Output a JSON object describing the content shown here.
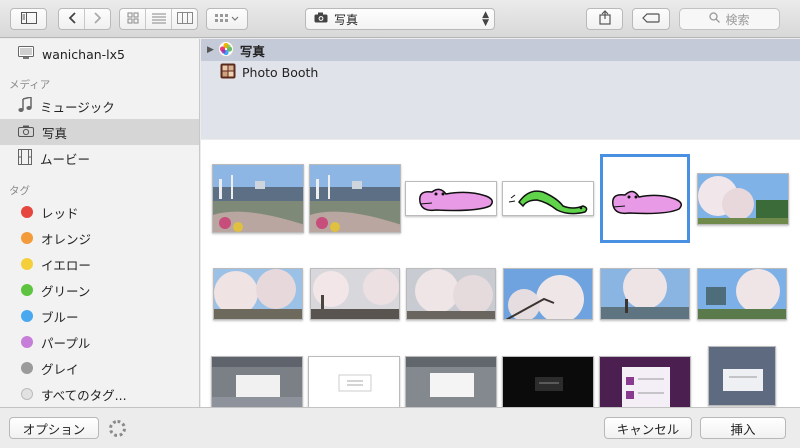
{
  "toolbar": {
    "source_popup": {
      "label": "写真",
      "icon": "camera-icon"
    },
    "search": {
      "placeholder": "検索",
      "icon": "magnifier-icon"
    },
    "icons": [
      "sidebar-toggle-icon",
      "back-arrow-icon",
      "forward-arrow-icon",
      "icon-view-icon",
      "list-view-icon",
      "column-view-icon",
      "group-by-icon",
      "share-icon",
      "tag-icon"
    ]
  },
  "sidebar": {
    "device": {
      "label": "wanichan-lx5",
      "icon": "computer-icon"
    },
    "media_header": "メディア",
    "media": [
      {
        "label": "ミュージック",
        "icon": "music-note-icon"
      },
      {
        "label": "写真",
        "icon": "camera-icon",
        "selected": true
      },
      {
        "label": "ムービー",
        "icon": "film-icon"
      }
    ],
    "tags_header": "タグ",
    "tags": [
      {
        "label": "レッド",
        "color": "#e5463e"
      },
      {
        "label": "オレンジ",
        "color": "#f39b3a"
      },
      {
        "label": "イエロー",
        "color": "#f5cf3b"
      },
      {
        "label": "グリーン",
        "color": "#5ec43f"
      },
      {
        "label": "ブルー",
        "color": "#4aa8ef"
      },
      {
        "label": "パープル",
        "color": "#c77ed8"
      },
      {
        "label": "グレイ",
        "color": "#9b9b9b"
      },
      {
        "label": "すべてのタグ...",
        "color": "#e2e2e2"
      }
    ]
  },
  "sources": [
    {
      "label": "写真",
      "icon": "photos-app-icon",
      "selected": true,
      "expandable": true
    },
    {
      "label": "Photo Booth",
      "icon": "photo-booth-icon",
      "selected": false
    }
  ],
  "grid": {
    "selected_index": 4,
    "rows": [
      [
        "harbor-photo",
        "harbor-photo",
        "pink-crocodile-drawing",
        "green-caterpillar-drawing",
        "pink-crocodile-drawing",
        "cherry-blossom-photo"
      ],
      [
        "cherry-blossom-photo",
        "cherry-blossom-photo",
        "cherry-blossom-photo",
        "cherry-blossom-photo",
        "cherry-blossom-photo",
        "cherry-blossom-photo"
      ],
      [
        "app-screenshot",
        "app-screenshot",
        "app-screenshot",
        "dark-screenshot",
        "purple-dialog-screenshot",
        "app-screenshot"
      ]
    ]
  },
  "bottom": {
    "options_label": "オプション",
    "cancel_label": "キャンセル",
    "insert_label": "挿入"
  }
}
